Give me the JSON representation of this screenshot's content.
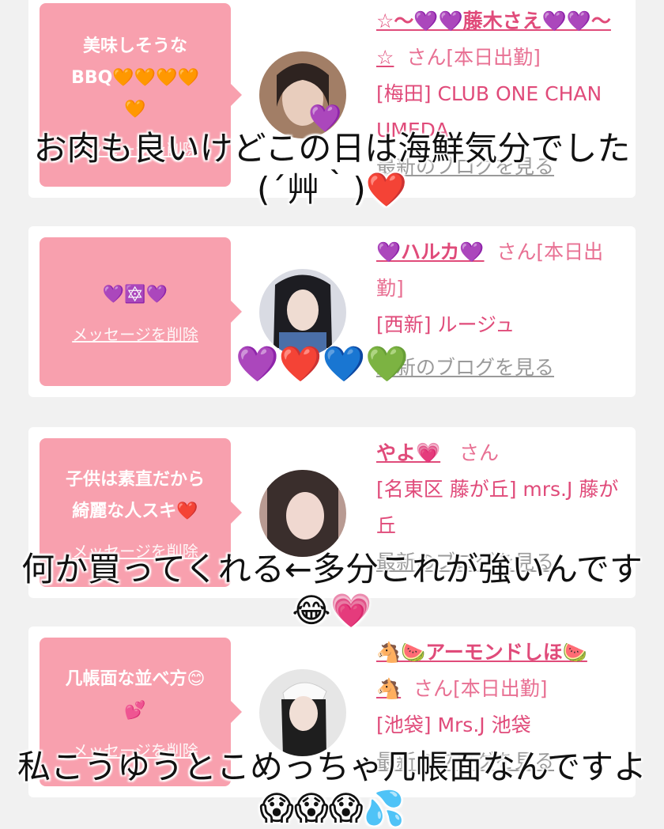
{
  "cards": [
    {
      "message": "美味しそうな\nBBQ🧡🧡🧡🧡\n🧡",
      "delete_label": "メッセージを削除",
      "name": "☆〜💜💜藤木さえ💜💜〜☆",
      "honorific": "さん[本日出勤]",
      "shop": "[梅田] CLUB ONE CHAN UMEDA",
      "blog_label": "最新のブログを見る",
      "avatar_bg": "#8a6a55"
    },
    {
      "message": "💜🔯💜",
      "delete_label": "メッセージを削除",
      "name": "💜ハルカ💜",
      "honorific": "さん[本日出勤]",
      "shop": "[西新] ルージュ",
      "blog_label": "最新のブログを見る",
      "avatar_bg": "#5a6f98"
    },
    {
      "message": "子供は素直だから\n綺麗な人スキ❤️",
      "delete_label": "メッセージを削除",
      "name": "やよ💗",
      "honorific": "さん",
      "shop": "[名東区 藤が丘] mrs.J 藤が丘",
      "blog_label": "最新のブログを見る",
      "avatar_bg": "#c8a8a0"
    },
    {
      "message": "几帳面な並べ方😊\n💕",
      "delete_label": "メッセージを削除",
      "name": "🐴🍉アーモンドしほ🍉🐴",
      "honorific": "さん[本日出勤]",
      "shop": "[池袋] Mrs.J 池袋",
      "blog_label": "最新のブログを見る",
      "avatar_bg": "#cfcfcf"
    }
  ],
  "captions": {
    "c1": "お肉も良いけどこの日は海鮮気分でした(´艸｀)❤️",
    "c2_hearts": "💜❤️💙💚",
    "c3": "何か買ってくれる←多分これが強いんです😂💗",
    "c4": "私こうゆうとこめっちゃ几帳面なんですよ😱😱😱💦"
  },
  "colors": {
    "bubble": "#f8a0ae",
    "name": "#e04b7a",
    "background": "#f1f1f1"
  }
}
